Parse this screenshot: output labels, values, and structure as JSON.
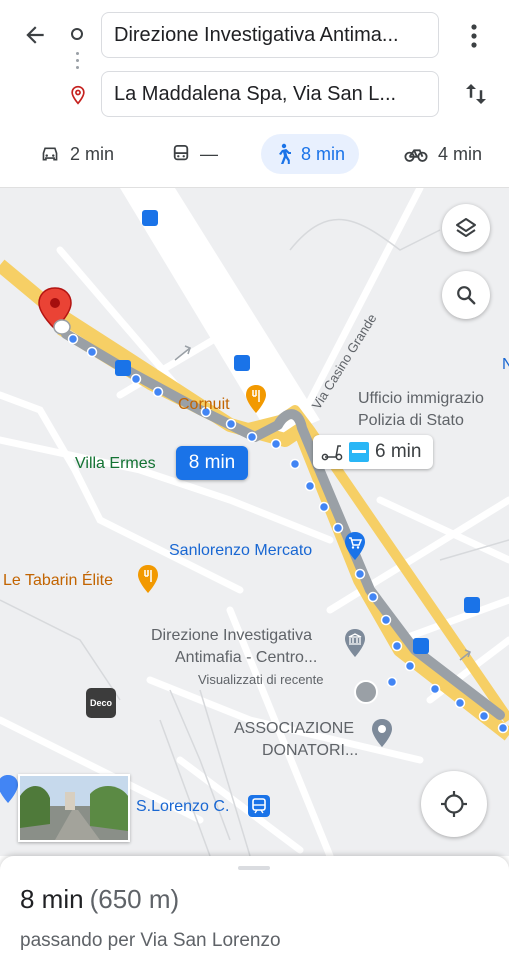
{
  "directions": {
    "origin": "Direzione Investigativa Antima...",
    "destination": "La Maddalena Spa, Via San L..."
  },
  "modes": [
    {
      "name": "drive",
      "label": "2 min"
    },
    {
      "name": "transit",
      "label": "—"
    },
    {
      "name": "walk",
      "label": "8 min",
      "active": true
    },
    {
      "name": "bike",
      "label": "4 min"
    }
  ],
  "map": {
    "labels": {
      "cornuit": "Cornuit",
      "villa_ermes": "Villa Ermes",
      "ufficio_line1": "Ufficio immigrazio",
      "ufficio_line2": "Polizia di Stato",
      "via_casino_grande": "Via Casino Grande",
      "sanlorenzo_mercato": "Sanlorenzo Mercato",
      "le_tabarin": "Le Tabarin Élite",
      "dia_line1": "Direzione Investigativa",
      "dia_line2": "Antimafia - Centro...",
      "dia_recent": "Visualizzati di recente",
      "associazione_line1": "ASSOCIAZIONE",
      "associazione_line2": "DONATORI...",
      "s_lorenzo": "S.Lorenzo C.",
      "edge_m": "N",
      "deco": "Deco"
    },
    "route_badge": "8 min",
    "scooter_badge": "6 min"
  },
  "colors": {
    "accent": "#1a73e8",
    "route_yellow": "#f6cf65",
    "destination_red": "#ea4335",
    "poi_orange": "#f29900",
    "poi_green": "#137333"
  },
  "sheet": {
    "duration": "8 min",
    "distance": "(650 m)",
    "via": "passando per Via San Lorenzo"
  }
}
